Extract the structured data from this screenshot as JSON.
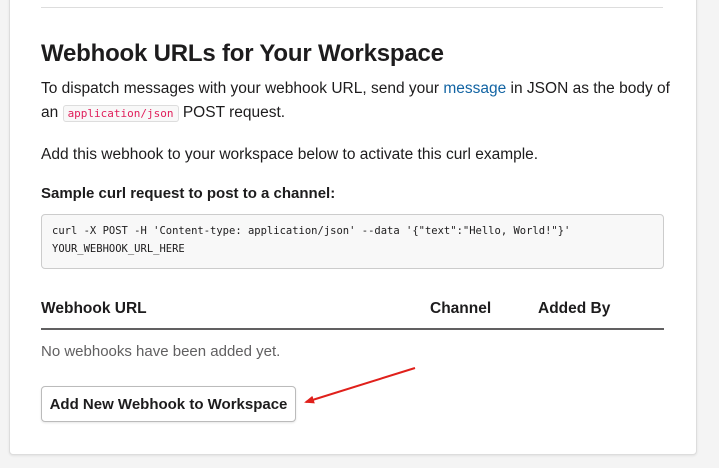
{
  "section": {
    "title": "Webhook URLs for Your Workspace",
    "intro_part1": "To dispatch messages with your webhook URL, send your ",
    "intro_link": "message",
    "intro_part2": " in JSON as the body of an ",
    "intro_code": "application/json",
    "intro_part3": " POST request.",
    "activate_note": "Add this webhook to your workspace below to activate this curl example.",
    "sample_label": "Sample curl request to post to a channel:",
    "curl_line1": "curl -X POST -H 'Content-type: application/json' --data '{\"text\":\"Hello, World!\"}'",
    "curl_line2": "YOUR_WEBHOOK_URL_HERE"
  },
  "table": {
    "headers": [
      "Webhook URL",
      "Channel",
      "Added By"
    ],
    "empty_message": "No webhooks have been added yet."
  },
  "actions": {
    "add_button_label": "Add New Webhook to Workspace"
  },
  "annotation": {
    "arrow_color": "#e0201b"
  }
}
